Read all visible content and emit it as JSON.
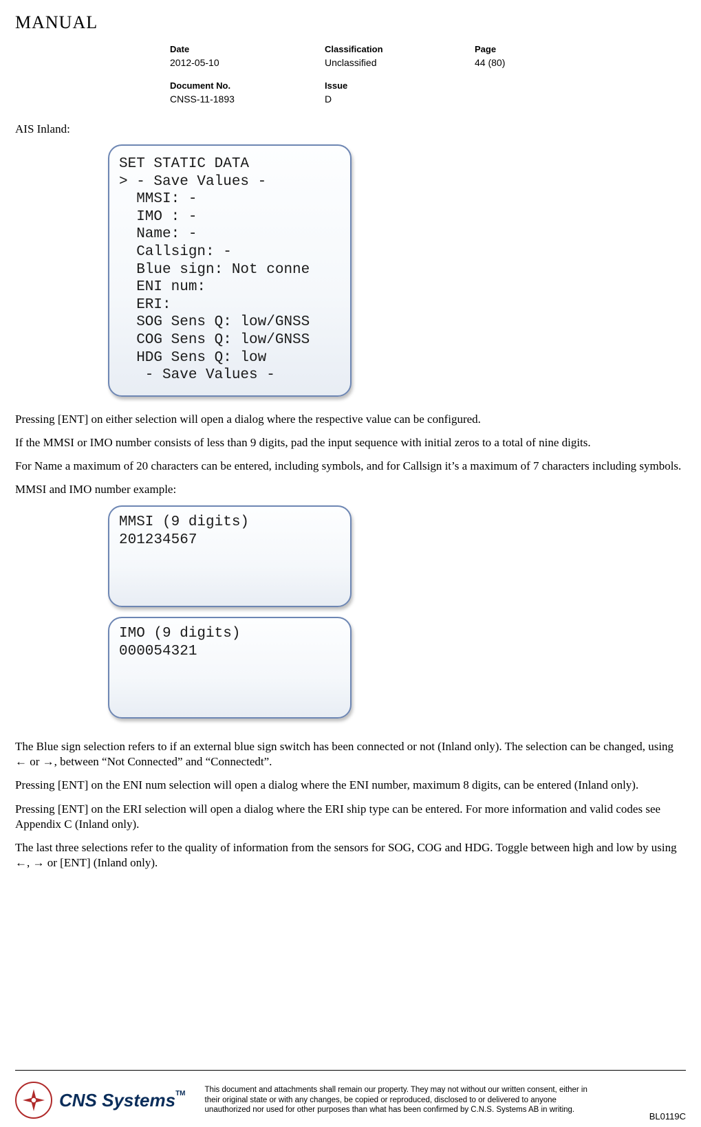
{
  "header": {
    "title": "MANUAL",
    "meta": {
      "date_label": "Date",
      "date": "2012-05-10",
      "classification_label": "Classification",
      "classification": "Unclassified",
      "page_label": "Page",
      "page": "44 (80)",
      "docno_label": "Document No.",
      "docno": "CNSS-11-1893",
      "issue_label": "Issue",
      "issue": "D"
    }
  },
  "intro_label": "AIS Inland:",
  "lcd1": {
    "l0": "SET STATIC DATA",
    "l1": "> - Save Values -",
    "l2": "  MMSI: -",
    "l3": "  IMO : -",
    "l4": "  Name: -",
    "l5": "  Callsign: -",
    "l6": "  Blue sign: Not conne",
    "l7": "  ENI num:",
    "l8": "  ERI:",
    "l9": "  SOG Sens Q: low/GNSS",
    "l10": "  COG Sens Q: low/GNSS",
    "l11": "  HDG Sens Q: low",
    "l12": "   - Save Values -"
  },
  "para": {
    "p1": "Pressing [ENT] on either selection will open a dialog where the respective value can be configured.",
    "p2": "If the MMSI or IMO number consists of less than 9 digits, pad the input sequence with initial zeros to a total of nine digits.",
    "p3": "For Name a maximum of 20 characters can be entered, including symbols, and for Callsign it’s a maximum of 7 characters including symbols.",
    "p4": "MMSI and IMO number example:"
  },
  "lcd2": {
    "l0": "MMSI (9 digits)",
    "l1": "201234567"
  },
  "lcd3": {
    "l0": "IMO (9 digits)",
    "l1": "000054321"
  },
  "para2": {
    "p5": "The Blue sign selection refers to if an external blue sign switch has been connected or not (Inland only). The selection can be changed, using ← or →, between “Not Connected” and “Connectedt”.",
    "p6": "Pressing [ENT] on the ENI num selection will open a dialog where the ENI number, maximum 8 digits, can be entered (Inland only).",
    "p7": "Pressing [ENT] on the ERI selection will open a dialog where the ERI ship type can be entered. For more information and valid codes see Appendix C (Inland only).",
    "p8": "The last three selections refer to the quality of information from the sensors for SOG, COG and HDG. Toggle between high and low by using ←, → or [ENT] (Inland only)."
  },
  "footer": {
    "company": "CNS Systems",
    "tm": "TM",
    "disclaimer": "This document and attachments shall remain our property. They may not without our written consent, either in their original state or with any changes, be copied or reproduced, disclosed to or delivered to anyone unauthorized nor used for other purposes than what has been confirmed by C.N.S. Systems AB in writing.",
    "code": "BL0119C"
  }
}
